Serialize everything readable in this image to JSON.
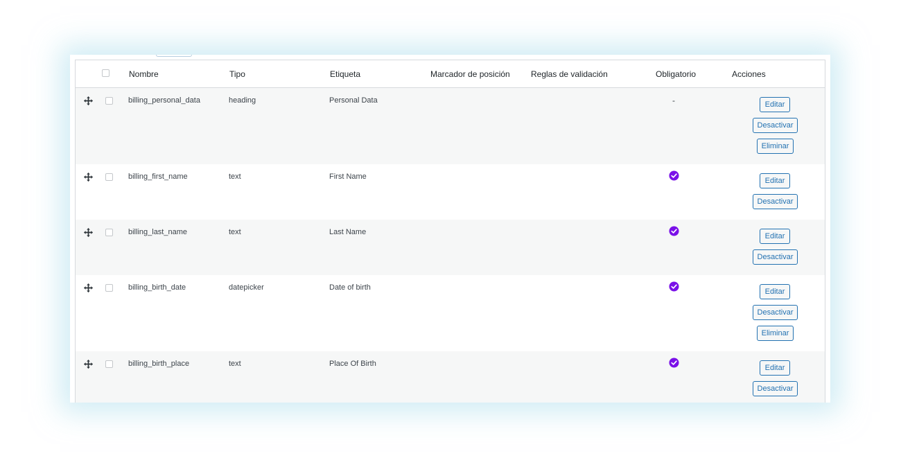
{
  "table": {
    "headers": {
      "nombre": "Nombre",
      "tipo": "Tipo",
      "etiqueta": "Etiqueta",
      "marcador": "Marcador de posición",
      "reglas": "Reglas de validación",
      "obligatorio": "Obligatorio",
      "acciones": "Acciones"
    },
    "rows": [
      {
        "nombre": "billing_personal_data",
        "tipo": "heading",
        "etiqueta": "Personal Data",
        "obligatorio": "-",
        "required": false
      },
      {
        "nombre": "billing_first_name",
        "tipo": "text",
        "etiqueta": "First Name",
        "obligatorio": "",
        "required": true
      },
      {
        "nombre": "billing_last_name",
        "tipo": "text",
        "etiqueta": "Last Name",
        "obligatorio": "",
        "required": true
      },
      {
        "nombre": "billing_birth_date",
        "tipo": "datepicker",
        "etiqueta": "Date of birth",
        "obligatorio": "",
        "required": true
      },
      {
        "nombre": "billing_birth_place",
        "tipo": "text",
        "etiqueta": "Place Of Birth",
        "obligatorio": "",
        "required": true
      }
    ]
  },
  "actions": {
    "edit_label": "Editar",
    "deactivate_label": "Desactivar",
    "delete_label": "Eliminar"
  },
  "colors": {
    "accent": "#2271b1",
    "required_check": "#7a10e8",
    "row_alt": "#f6f7f7",
    "glow": "#aadceb"
  },
  "icons": {
    "drag": "drag-move-icon",
    "required": "check-circle-icon"
  }
}
